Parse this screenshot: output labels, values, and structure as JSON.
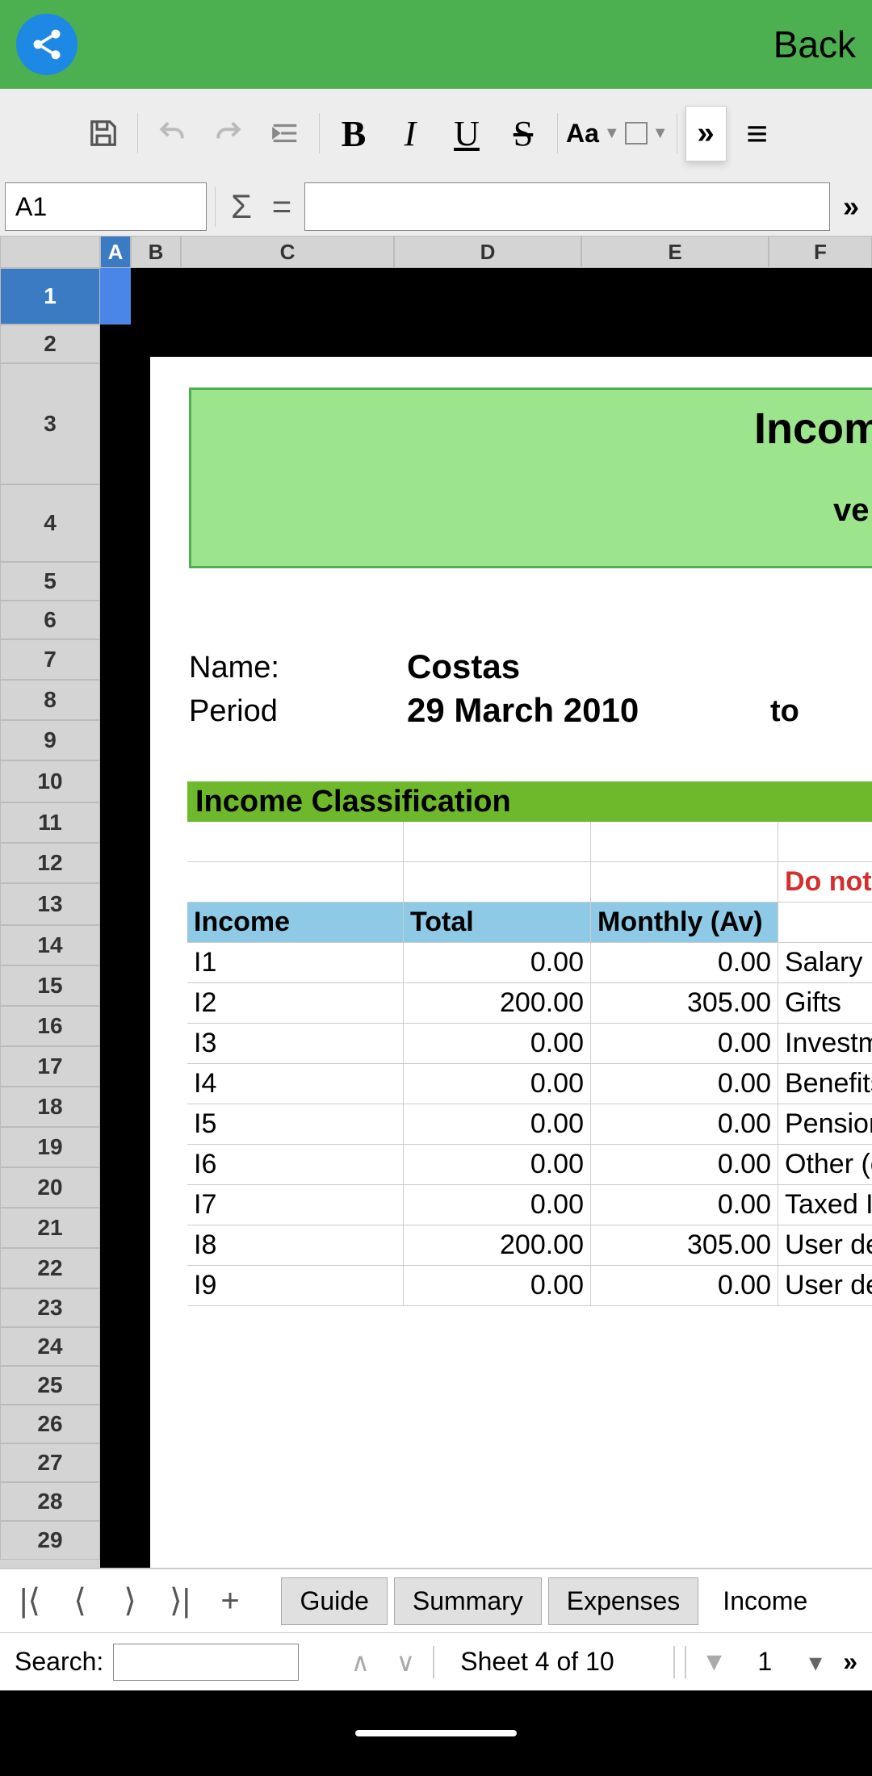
{
  "header": {
    "back": "Back"
  },
  "toolbar": {
    "bold": "B",
    "italic": "I",
    "underline": "U",
    "strike": "S",
    "font_size": "Aa",
    "expand": "»"
  },
  "formula_bar": {
    "cell_ref": "A1",
    "sigma": "Σ",
    "eq": "=",
    "expand": "»"
  },
  "columns": [
    "A",
    "B",
    "C",
    "D",
    "E",
    "F"
  ],
  "rows": [
    "1",
    "2",
    "3",
    "4",
    "5",
    "6",
    "7",
    "8",
    "9",
    "10",
    "11",
    "12",
    "13",
    "14",
    "15",
    "16",
    "17",
    "18",
    "19",
    "20",
    "21",
    "22",
    "23",
    "24",
    "25",
    "26",
    "27",
    "28",
    "29"
  ],
  "doc": {
    "title_partial": "Incom",
    "subtitle_partial": "ve",
    "name_label": "Name:",
    "name_value": "Costas",
    "period_label": "Period",
    "period_value": "29 March 2010",
    "period_to": "to",
    "section": "Income Classification",
    "warn": "Do not m",
    "headers": {
      "income": "Income",
      "total": "Total",
      "monthly": "Monthly (Av)"
    },
    "income_rows": [
      {
        "id": "I1",
        "total": "0.00",
        "monthly": "0.00",
        "desc": "Salary"
      },
      {
        "id": "I2",
        "total": "200.00",
        "monthly": "305.00",
        "desc": "Gifts"
      },
      {
        "id": "I3",
        "total": "0.00",
        "monthly": "0.00",
        "desc": "Investme"
      },
      {
        "id": "I4",
        "total": "0.00",
        "monthly": "0.00",
        "desc": "Benefits"
      },
      {
        "id": "I5",
        "total": "0.00",
        "monthly": "0.00",
        "desc": "Pension"
      },
      {
        "id": "I6",
        "total": "0.00",
        "monthly": "0.00",
        "desc": "Other (ca"
      },
      {
        "id": "I7",
        "total": "0.00",
        "monthly": "0.00",
        "desc": "Taxed Int"
      },
      {
        "id": "I8",
        "total": "200.00",
        "monthly": "305.00",
        "desc": "User defi"
      },
      {
        "id": "I9",
        "total": "0.00",
        "monthly": "0.00",
        "desc": "User defi"
      }
    ]
  },
  "tabs": {
    "guide": "Guide",
    "summary": "Summary",
    "expenses": "Expenses",
    "income": "Income"
  },
  "search": {
    "label": "Search:",
    "sheet_status": "Sheet 4 of 10",
    "page": "1",
    "expand": "»"
  }
}
